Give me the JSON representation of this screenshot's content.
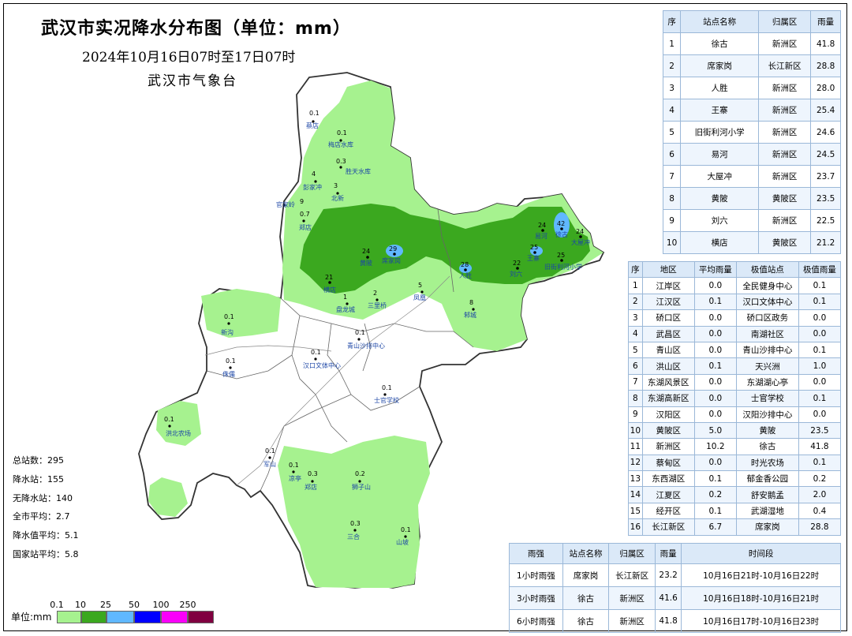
{
  "header": {
    "title": "武汉市实况降水分布图（单位：mm）",
    "period": "2024年10月16日07时至17日07时",
    "agency": "武汉市气象台"
  },
  "stats": {
    "total_stations": "总站数：295",
    "rain_stations": "降水站：155",
    "no_rain_stations": "无降水站：140",
    "city_avg": "全市平均：2.7",
    "rain_avg": "降水值平均：5.1",
    "national_avg": "国家站平均：5.8"
  },
  "legend": {
    "unit": "单位:mm",
    "ticks": [
      "0.1",
      "10",
      "25",
      "50",
      "100",
      "250"
    ],
    "colors": [
      "#a6f28f",
      "#3ba81f",
      "#60b8ff",
      "#0000ff",
      "#fa00fa",
      "#800040"
    ]
  },
  "colors": {
    "light_rain": "#a6f28f",
    "moderate_rain": "#3ba81f",
    "heavy_rain": "#60b8ff",
    "table_header": "#dbe9f8",
    "table_border": "#9bb8d8",
    "station_label": "#1c46a6"
  },
  "top_stations": {
    "headers": [
      "序",
      "站点名称",
      "归属区",
      "雨量"
    ],
    "rows": [
      [
        "1",
        "徐古",
        "新洲区",
        "41.8"
      ],
      [
        "2",
        "席家岗",
        "长江新区",
        "28.8"
      ],
      [
        "3",
        "人胜",
        "新洲区",
        "28.0"
      ],
      [
        "4",
        "王寨",
        "新洲区",
        "25.4"
      ],
      [
        "5",
        "旧街利河小学",
        "新洲区",
        "24.6"
      ],
      [
        "6",
        "易河",
        "新洲区",
        "24.5"
      ],
      [
        "7",
        "大屋冲",
        "新洲区",
        "23.7"
      ],
      [
        "8",
        "黄陂",
        "黄陂区",
        "23.5"
      ],
      [
        "9",
        "刘六",
        "新洲区",
        "22.5"
      ],
      [
        "10",
        "横店",
        "黄陂区",
        "21.2"
      ]
    ]
  },
  "district_stats": {
    "headers": [
      "序",
      "地区",
      "平均雨量",
      "极值站点",
      "极值雨量"
    ],
    "rows": [
      [
        "1",
        "江岸区",
        "0.0",
        "全民健身中心",
        "0.1"
      ],
      [
        "2",
        "江汉区",
        "0.1",
        "汉口文体中心",
        "0.1"
      ],
      [
        "3",
        "硚口区",
        "0.0",
        "硚口区政务",
        "0.0"
      ],
      [
        "4",
        "武昌区",
        "0.0",
        "南湖社区",
        "0.0"
      ],
      [
        "5",
        "青山区",
        "0.0",
        "青山沙排中心",
        "0.1"
      ],
      [
        "6",
        "洪山区",
        "0.1",
        "天兴洲",
        "1.0"
      ],
      [
        "7",
        "东湖风景区",
        "0.0",
        "东湖湖心亭",
        "0.0"
      ],
      [
        "8",
        "东湖高新区",
        "0.0",
        "士官学校",
        "0.1"
      ],
      [
        "9",
        "汉阳区",
        "0.0",
        "汉阳沙排中心",
        "0.0"
      ],
      [
        "10",
        "黄陂区",
        "5.0",
        "黄陂",
        "23.5"
      ],
      [
        "11",
        "新洲区",
        "10.2",
        "徐古",
        "41.8"
      ],
      [
        "12",
        "蔡甸区",
        "0.0",
        "时光农场",
        "0.1"
      ],
      [
        "13",
        "东西湖区",
        "0.1",
        "郁金香公园",
        "0.2"
      ],
      [
        "14",
        "江夏区",
        "0.2",
        "舒安鹅孟",
        "2.0"
      ],
      [
        "15",
        "经开区",
        "0.1",
        "武湖湿地",
        "0.4"
      ],
      [
        "16",
        "长江新区",
        "6.7",
        "席家岗",
        "28.8"
      ]
    ]
  },
  "intensity": {
    "headers": [
      "雨强",
      "站点名称",
      "归属区",
      "雨量",
      "时间段"
    ],
    "rows": [
      [
        "1小时雨强",
        "席家岗",
        "长江新区",
        "23.2",
        "10月16日21时-10月16日22时"
      ],
      [
        "3小时雨强",
        "徐古",
        "新洲区",
        "41.6",
        "10月16日18时-10月16日21时"
      ],
      [
        "6小时雨强",
        "徐古",
        "新洲区",
        "41.8",
        "10月16日17时-10月16日23时"
      ]
    ]
  },
  "map": {
    "labels": [
      {
        "text": "蔡店",
        "value": "0.1"
      },
      {
        "text": "梅店水库",
        "value": "0.1"
      },
      {
        "text": "彭家冲",
        "value": "4"
      },
      {
        "text": "北新",
        "value": "3"
      },
      {
        "text": "胜天水库",
        "value": "0.3"
      },
      {
        "text": "官家岭",
        "value": "9"
      },
      {
        "text": "郑店",
        "value": "0.7"
      },
      {
        "text": "黄陂",
        "value": "24"
      },
      {
        "text": "横店",
        "value": "21"
      },
      {
        "text": "席家岗",
        "value": "29"
      },
      {
        "text": "三里桥",
        "value": "2"
      },
      {
        "text": "盘龙城",
        "value": "1"
      },
      {
        "text": "汉口文体中心",
        "value": "0.1"
      },
      {
        "text": "青山沙排中心",
        "value": "0.1"
      },
      {
        "text": "士官学校",
        "value": "0.1"
      },
      {
        "text": "新沟",
        "value": "0.1"
      },
      {
        "text": "侏儒",
        "value": "0.1"
      },
      {
        "text": "洪北农场",
        "value": "0.1"
      },
      {
        "text": "军山",
        "value": "0.1"
      },
      {
        "text": "凉亭",
        "value": "0.1"
      },
      {
        "text": "郑店",
        "value": "0.3"
      },
      {
        "text": "狮子山",
        "value": "0.2"
      },
      {
        "text": "三合",
        "value": "0.3"
      },
      {
        "text": "山坡",
        "value": "0.1"
      },
      {
        "text": "邾城",
        "value": "8"
      },
      {
        "text": "凤凰",
        "value": "5"
      },
      {
        "text": "徐古",
        "value": "42"
      },
      {
        "text": "易河",
        "value": "24"
      },
      {
        "text": "王寨",
        "value": "25"
      },
      {
        "text": "人胜",
        "value": "28"
      },
      {
        "text": "刘六",
        "value": "22"
      },
      {
        "text": "旧街利河小学",
        "value": "25"
      },
      {
        "text": "大屋冲",
        "value": "24"
      }
    ]
  }
}
